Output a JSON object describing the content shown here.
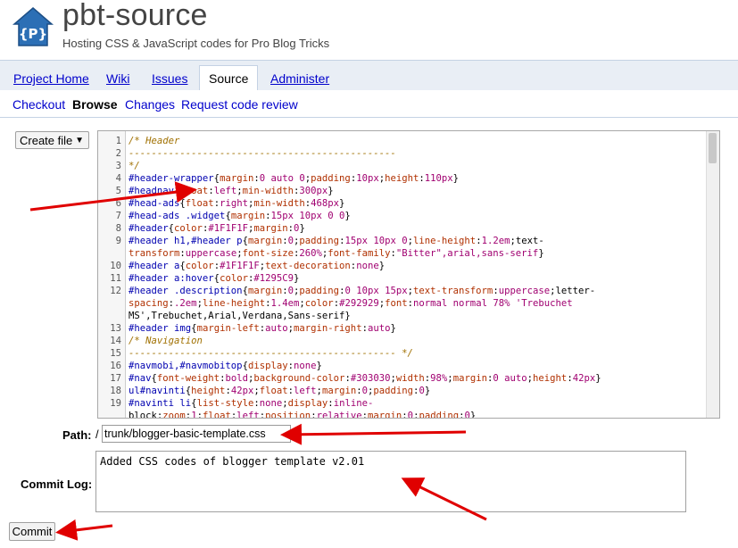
{
  "header": {
    "title": "pbt-source",
    "subtitle": "Hosting CSS & JavaScript codes for Pro Blog Tricks",
    "logo_text": "{P}"
  },
  "nav": {
    "tabs": [
      {
        "label": "Project Home",
        "active": false
      },
      {
        "label": "Wiki",
        "active": false
      },
      {
        "label": "Issues",
        "active": false
      },
      {
        "label": "Source",
        "active": true
      },
      {
        "label": "Administer",
        "active": false
      }
    ],
    "subnav": [
      {
        "label": "Checkout",
        "active": false
      },
      {
        "label": "Browse",
        "active": true
      },
      {
        "label": "Changes",
        "active": false
      },
      {
        "label": "Request code review",
        "active": false
      }
    ]
  },
  "toolbar": {
    "create_file_label": "Create file",
    "create_file_arrow": "▼"
  },
  "editor": {
    "line_numbers": [
      "1",
      "2",
      "3",
      "4",
      "5",
      "6",
      "7",
      "8",
      "9",
      "",
      "10",
      "11",
      "12",
      "",
      "",
      "13",
      "14",
      "15",
      "16",
      "17",
      "18",
      "19",
      ""
    ],
    "lines": [
      "/* Header",
      "-----------------------------------------------",
      "*/",
      "#header-wrapper{margin:0 auto 0;padding:10px;height:110px}",
      "#headnav{float:left;min-width:300px}",
      "#head-ads{float:right;min-width:468px}",
      "#head-ads .widget{margin:15px 10px 0 0}",
      "#header{color:#1F1F1F;margin:0}",
      "#header h1,#header p{margin:0;padding:15px 10px 0;line-height:1.2em;text-",
      "transform:uppercase;font-size:260%;font-family:\"Bitter\",arial,sans-serif}",
      "#header a{color:#1F1F1F;text-decoration:none}",
      "#header a:hover{color:#1295C9}",
      "#header .description{margin:0;padding:0 10px 15px;text-transform:uppercase;letter-",
      "spacing:.2em;line-height:1.4em;color:#292929;font:normal normal 78% 'Trebuchet",
      "MS',Trebuchet,Arial,Verdana,Sans-serif}",
      "#header img{margin-left:auto;margin-right:auto}",
      "/* Navigation",
      "----------------------------------------------- */",
      "#navmobi,#navmobitop{display:none}",
      "#nav{font-weight:bold;background-color:#303030;width:98%;margin:0 auto;height:42px}",
      "ul#navinti{height:42px;float:left;margin:0;padding:0}",
      "#navinti li{list-style:none;display:inline-",
      "block;zoom:1;float:left;position:relative;margin:0;padding:0}"
    ]
  },
  "form": {
    "path_label": "Path:",
    "path_prefix": "/",
    "path_value": "trunk/blogger-basic-template.css",
    "commit_log_label": "Commit Log:",
    "commit_log_value": "Added CSS codes of blogger template v2.01",
    "commit_button": "Commit"
  },
  "colors": {
    "link": "#0000cc",
    "tab_bar": "#e9eef5",
    "annotation_arrow": "#e00000"
  }
}
